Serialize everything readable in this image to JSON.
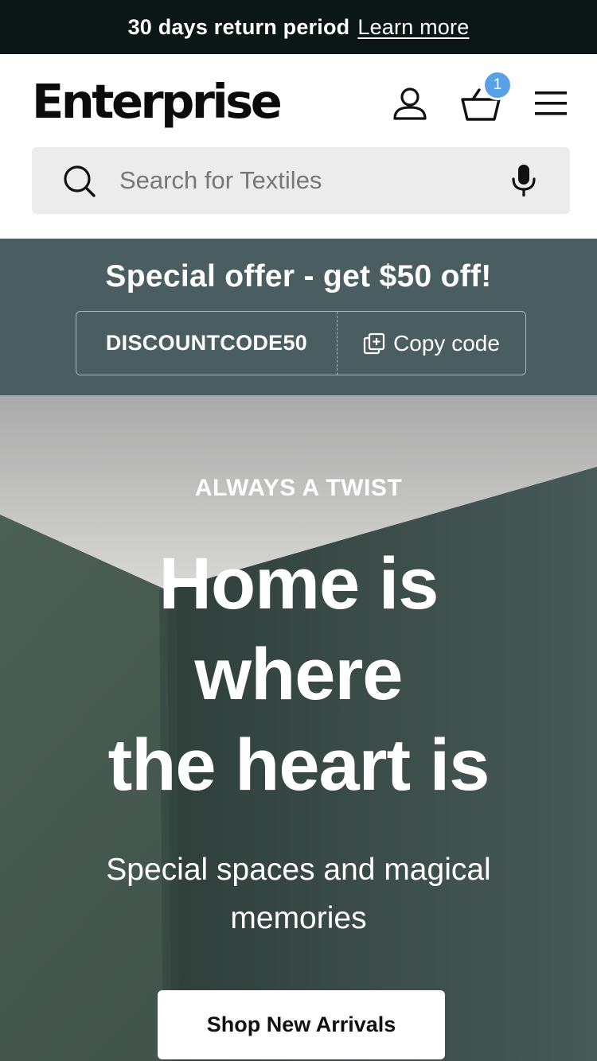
{
  "announcement": {
    "text": "30 days return period",
    "link_label": "Learn more"
  },
  "header": {
    "logo_text": "Enterprise",
    "cart_count": "1",
    "icons": [
      "account-icon",
      "cart-icon",
      "menu-icon"
    ]
  },
  "search": {
    "placeholder": "Search for Textiles",
    "icons": [
      "search-icon",
      "microphone-icon"
    ]
  },
  "promo": {
    "title": "Special offer - get $50 off!",
    "code": "DISCOUNTCODE50",
    "copy_label": "Copy code"
  },
  "hero": {
    "kicker": "ALWAYS A TWIST",
    "title_lines": [
      "Home is",
      "where",
      "the heart is"
    ],
    "subtitle_lines": [
      "Special spaces and magical",
      "memories"
    ],
    "button_label": "Shop New Arrivals"
  },
  "colors": {
    "announcement_bg": "#0b1716",
    "promo_bg": "#4a5e62",
    "badge": "#5aa0e6",
    "hero_wall": "#3e5048"
  }
}
